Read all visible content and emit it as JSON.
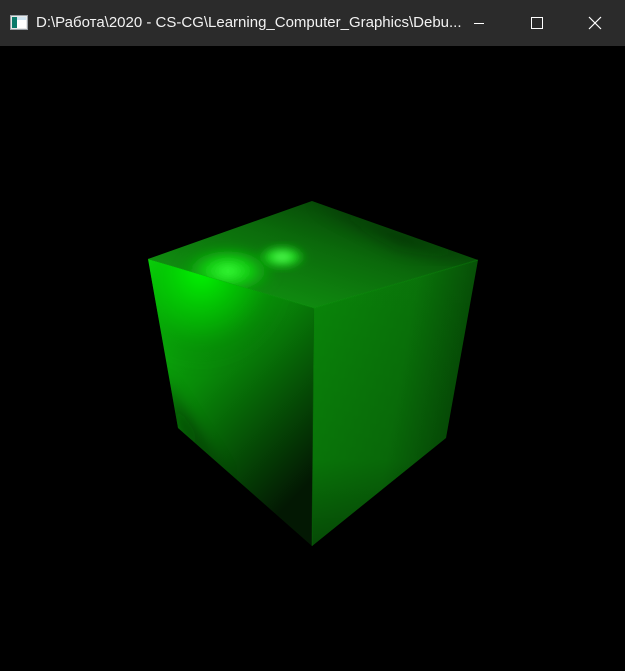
{
  "window": {
    "title": "D:\\Работа\\2020 - CS-CG\\Learning_Computer_Graphics\\Debu...",
    "icons": {
      "app": "application-window-icon",
      "minimize": "minimize-icon",
      "maximize": "maximize-icon",
      "close": "close-icon"
    }
  },
  "scene": {
    "object": "cube",
    "background_color": "#000000",
    "cube_color": "#00ff00",
    "shading": "lit-with-specular-highlights"
  }
}
